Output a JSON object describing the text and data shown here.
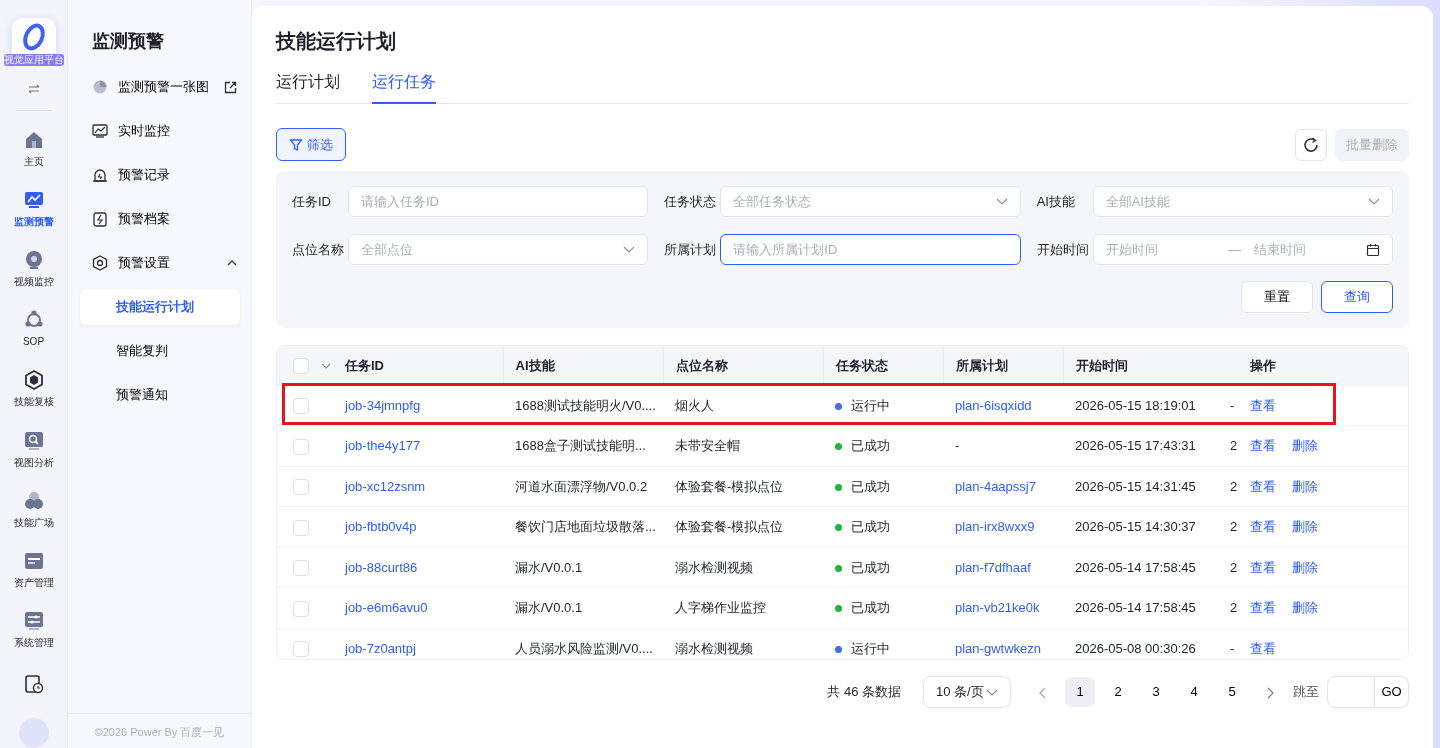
{
  "rail": {
    "logo_label": "视觉应用平台",
    "items": [
      {
        "label": "主页",
        "selected": false
      },
      {
        "label": "监测预警",
        "selected": true
      },
      {
        "label": "视频监控",
        "selected": false
      },
      {
        "label": "SOP",
        "selected": false
      },
      {
        "label": "技能复核",
        "selected": false
      },
      {
        "label": "视图分析",
        "selected": false
      },
      {
        "label": "技能广场",
        "selected": false
      },
      {
        "label": "资产管理",
        "selected": false
      },
      {
        "label": "系统管理",
        "selected": false
      }
    ]
  },
  "submenu": {
    "title": "监测预警",
    "footer": "©2026 Power By 百度一见",
    "items": [
      {
        "label": "监测预警一张图",
        "external": true,
        "selected": false
      },
      {
        "label": "实时监控",
        "external": false,
        "selected": false
      },
      {
        "label": "预警记录",
        "external": false,
        "selected": false
      },
      {
        "label": "预警档案",
        "external": false,
        "selected": false
      },
      {
        "label": "预警设置",
        "external": false,
        "selected": false,
        "expanded": true,
        "children": [
          {
            "label": "技能运行计划",
            "selected": true
          },
          {
            "label": "智能复判",
            "selected": false
          },
          {
            "label": "预警通知",
            "selected": false
          }
        ]
      }
    ]
  },
  "page": {
    "title": "技能运行计划",
    "tabs": [
      {
        "label": "运行计划",
        "selected": false
      },
      {
        "label": "运行任务",
        "selected": true
      }
    ],
    "filter_button": "筛选",
    "batch_delete": {
      "label": "批量删除",
      "disabled": true
    },
    "filters": [
      {
        "label": "任务ID",
        "kind": "input",
        "placeholder": "请输入任务ID",
        "focused": false
      },
      {
        "label": "任务状态",
        "kind": "select",
        "placeholder": "全部任务状态",
        "focused": false
      },
      {
        "label": "AI技能",
        "kind": "select",
        "placeholder": "全部AI技能",
        "focused": false
      },
      {
        "label": "点位名称",
        "kind": "select",
        "placeholder": "全部点位",
        "focused": false
      },
      {
        "label": "所属计划",
        "kind": "input",
        "placeholder": "请输入所属计划ID",
        "focused": true
      },
      {
        "label": "开始时间",
        "kind": "daterange",
        "placeholder": "开始时间",
        "placeholder_end": "结束时间",
        "separator": "—",
        "focused": false
      }
    ],
    "reset_button": "重置",
    "query_button": "查询"
  },
  "table": {
    "header_checked": false,
    "columns": [
      "任务ID",
      "AI技能",
      "点位名称",
      "任务状态",
      "所属计划",
      "开始时间",
      "操作"
    ],
    "rows": [
      {
        "checked": false,
        "highlighted": true,
        "task_id": "job-34jmnpfg",
        "skill": "1688测试技能明火/V0....",
        "point": "烟火人",
        "status": {
          "text": "运行中",
          "color": "#3d6ef5"
        },
        "plan": "plan-6isqxidd",
        "plan_linked": true,
        "start": "2026-05-15 18:19:01",
        "column_8": "-",
        "actions": [
          "查看"
        ]
      },
      {
        "checked": false,
        "highlighted": false,
        "task_id": "job-the4y177",
        "skill": "1688盒子测试技能明...",
        "point": "未带安全帽",
        "status": {
          "text": "已成功",
          "color": "#1fb53a"
        },
        "plan": "-",
        "plan_linked": false,
        "start": "2026-05-15 17:43:31",
        "column_8": "2",
        "actions": [
          "查看",
          "删除"
        ]
      },
      {
        "checked": false,
        "highlighted": false,
        "task_id": "job-xc12zsnm",
        "skill": "河道水面漂浮物/V0.0.2",
        "point": "体验套餐-模拟点位",
        "status": {
          "text": "已成功",
          "color": "#1fb53a"
        },
        "plan": "plan-4aapssj7",
        "plan_linked": true,
        "start": "2026-05-15 14:31:45",
        "column_8": "2",
        "actions": [
          "查看",
          "删除"
        ]
      },
      {
        "checked": false,
        "highlighted": false,
        "task_id": "job-fbtb0v4p",
        "skill": "餐饮门店地面垃圾散落...",
        "point": "体验套餐-模拟点位",
        "status": {
          "text": "已成功",
          "color": "#1fb53a"
        },
        "plan": "plan-irx8wxx9",
        "plan_linked": true,
        "start": "2026-05-15 14:30:37",
        "column_8": "2",
        "actions": [
          "查看",
          "删除"
        ]
      },
      {
        "checked": false,
        "highlighted": false,
        "task_id": "job-88curt86",
        "skill": "漏水/V0.0.1",
        "point": "溺水检测视频",
        "status": {
          "text": "已成功",
          "color": "#1fb53a"
        },
        "plan": "plan-f7dfhaaf",
        "plan_linked": true,
        "start": "2026-05-14 17:58:45",
        "column_8": "2",
        "actions": [
          "查看",
          "删除"
        ]
      },
      {
        "checked": false,
        "highlighted": false,
        "task_id": "job-e6m6avu0",
        "skill": "漏水/V0.0.1",
        "point": "人字梯作业监控",
        "status": {
          "text": "已成功",
          "color": "#1fb53a"
        },
        "plan": "plan-vb21ke0k",
        "plan_linked": true,
        "start": "2026-05-14 17:58:45",
        "column_8": "2",
        "actions": [
          "查看",
          "删除"
        ]
      },
      {
        "checked": false,
        "highlighted": false,
        "task_id": "job-7z0antpj",
        "skill": "人员溺水风险监测/V0....",
        "point": "溺水检测视频",
        "status": {
          "text": "运行中",
          "color": "#3d6ef5"
        },
        "plan": "plan-gwtwkezn",
        "plan_linked": true,
        "start": "2026-05-08 00:30:26",
        "column_8": "-",
        "actions": [
          "查看"
        ]
      }
    ]
  },
  "pagination": {
    "total": "共 46 条数据",
    "page_size": "10 条/页",
    "pages": [
      {
        "label": "1",
        "selected": true
      },
      {
        "label": "2",
        "selected": false
      },
      {
        "label": "3",
        "selected": false
      },
      {
        "label": "4",
        "selected": false
      },
      {
        "label": "5",
        "selected": false
      }
    ],
    "jump_label": "跳至",
    "go": "GO"
  }
}
